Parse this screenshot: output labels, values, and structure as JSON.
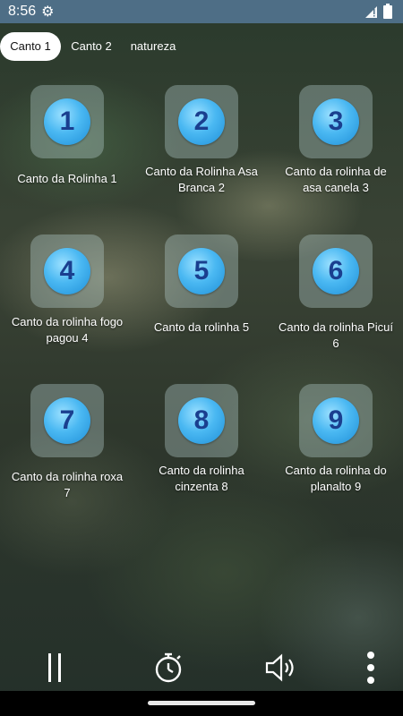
{
  "status_bar": {
    "time": "8:56",
    "gear_icon": "gear-icon",
    "signal_icon": "signal-icon",
    "battery_icon": "battery-icon"
  },
  "tabs": [
    {
      "label": "Canto 1",
      "active": true
    },
    {
      "label": "Canto 2",
      "active": false
    },
    {
      "label": "natureza",
      "active": false
    }
  ],
  "sounds": [
    {
      "number": "1",
      "label": "Canto da Rolinha 1"
    },
    {
      "number": "2",
      "label": "Canto da Rolinha Asa Branca 2"
    },
    {
      "number": "3",
      "label": "Canto da rolinha de asa canela 3"
    },
    {
      "number": "4",
      "label": "Canto da rolinha fogo pagou 4"
    },
    {
      "number": "5",
      "label": "Canto da rolinha 5"
    },
    {
      "number": "6",
      "label": "Canto da rolinha Picuí 6"
    },
    {
      "number": "7",
      "label": "Canto da rolinha roxa 7"
    },
    {
      "number": "8",
      "label": "Canto da rolinha cinzenta 8"
    },
    {
      "number": "9",
      "label": "Canto da rolinha do planalto 9"
    }
  ],
  "controls": {
    "pause_icon": "pause-icon",
    "timer_icon": "timer-icon",
    "volume_icon": "volume-icon",
    "menu_icon": "more-vertical-icon"
  },
  "colors": {
    "status_bar": "#4e6e86",
    "badge": "#2fa5ea",
    "badge_number": "#1a3f8f"
  }
}
